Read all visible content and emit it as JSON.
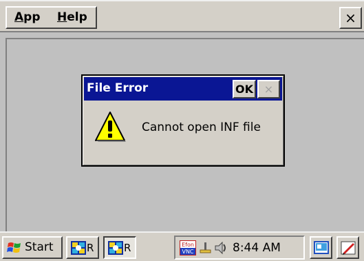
{
  "menubar": {
    "app_label": "App",
    "app_accel": "A",
    "app_rest": "pp",
    "help_label": "Help",
    "help_accel": "H",
    "help_rest": "elp",
    "close_glyph": "×"
  },
  "dialog": {
    "title": "File Error",
    "ok_label": "OK",
    "close_glyph": "×",
    "message": "Cannot open INF file",
    "icon": "warning-icon"
  },
  "taskbar": {
    "start_label": "Start",
    "tasks": [
      {
        "label": "R",
        "active": false
      },
      {
        "label": "R",
        "active": true
      }
    ],
    "tray": {
      "vnc_top": "Efon",
      "vnc_bottom": "VNC",
      "time": "8:44 AM"
    }
  },
  "colors": {
    "title_bar": "#0a1694",
    "face": "#d4d0c8",
    "desktop": "#c0c0c0"
  }
}
